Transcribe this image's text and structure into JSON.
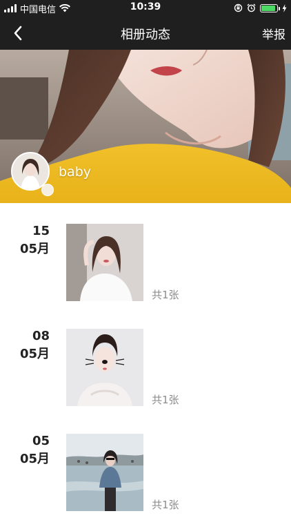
{
  "status_bar": {
    "carrier": "中国电信",
    "time": "10:39",
    "battery_color": "#4cd964"
  },
  "nav": {
    "back_icon": "chevron-left-icon",
    "title": "相册动态",
    "report_label": "举报"
  },
  "profile": {
    "username": "baby"
  },
  "timeline": [
    {
      "day": "15",
      "month": "05月",
      "count_label": "共1张"
    },
    {
      "day": "08",
      "month": "05月",
      "count_label": "共1张"
    },
    {
      "day": "05",
      "month": "05月",
      "count_label": "共1张"
    }
  ]
}
